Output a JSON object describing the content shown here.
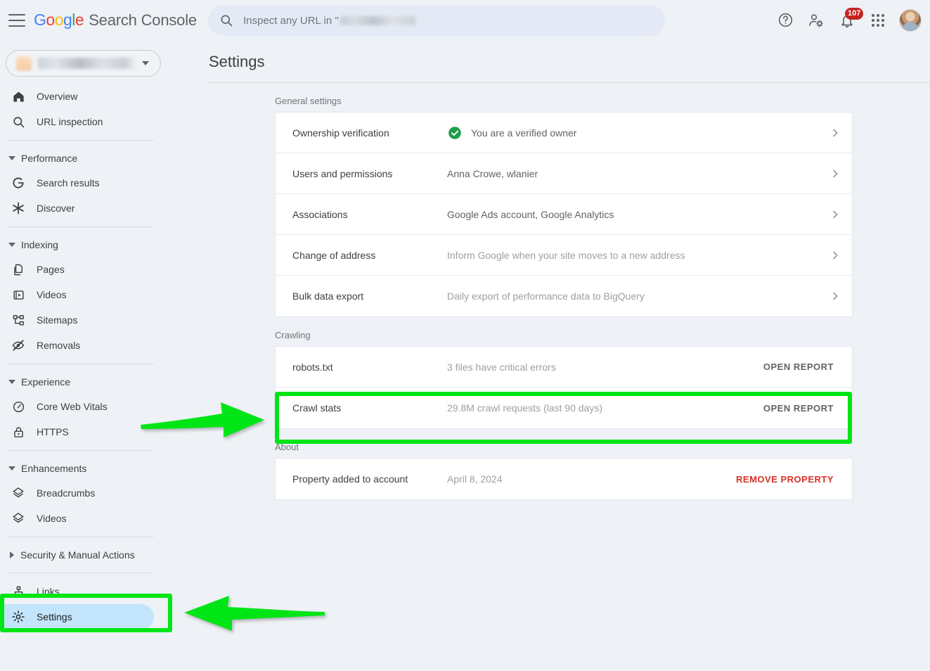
{
  "app": {
    "brand_google": "Google",
    "brand_product": "Search Console",
    "menu_icon": "hamburger-icon"
  },
  "search": {
    "placeholder_prefix": "Inspect any URL in \"",
    "icon": "search-icon"
  },
  "top_actions": {
    "help_label": "?",
    "help_icon": "help-icon",
    "account_icon": "account-settings-icon",
    "notifications_icon": "notifications-bell-icon",
    "notifications_count": "107",
    "apps_icon": "apps-grid-icon",
    "avatar_icon": "user-avatar"
  },
  "property_selector": {
    "value": "",
    "icon": "site-favicon",
    "chevron": "chevron-down-icon"
  },
  "sidebar": {
    "items": [
      {
        "label": "Overview",
        "icon": "home-icon",
        "type": "item",
        "active": false
      },
      {
        "label": "URL inspection",
        "icon": "search-icon",
        "type": "item",
        "active": false
      },
      {
        "label": "Performance",
        "icon": "triangle-down-icon",
        "type": "group",
        "expanded": true
      },
      {
        "label": "Search results",
        "icon": "google-g-icon",
        "type": "item",
        "active": false
      },
      {
        "label": "Discover",
        "icon": "discover-asterisk-icon",
        "type": "item",
        "active": false
      },
      {
        "label": "Indexing",
        "icon": "triangle-down-icon",
        "type": "group",
        "expanded": true
      },
      {
        "label": "Pages",
        "icon": "pages-icon",
        "type": "item",
        "active": false
      },
      {
        "label": "Videos",
        "icon": "video-icon",
        "type": "item",
        "active": false
      },
      {
        "label": "Sitemaps",
        "icon": "sitemaps-icon",
        "type": "item",
        "active": false
      },
      {
        "label": "Removals",
        "icon": "eye-off-icon",
        "type": "item",
        "active": false
      },
      {
        "label": "Experience",
        "icon": "triangle-down-icon",
        "type": "group",
        "expanded": true
      },
      {
        "label": "Core Web Vitals",
        "icon": "speedometer-icon",
        "type": "item",
        "active": false
      },
      {
        "label": "HTTPS",
        "icon": "lock-icon",
        "type": "item",
        "active": false
      },
      {
        "label": "Enhancements",
        "icon": "triangle-down-icon",
        "type": "group",
        "expanded": true
      },
      {
        "label": "Breadcrumbs",
        "icon": "layers-icon",
        "type": "item",
        "active": false
      },
      {
        "label": "Videos",
        "icon": "layers-icon",
        "type": "item",
        "active": false
      },
      {
        "label": "Security & Manual Actions",
        "icon": "triangle-right-icon",
        "type": "group",
        "expanded": false
      },
      {
        "label": "Links",
        "icon": "links-hierarchy-icon",
        "type": "item",
        "active": false
      },
      {
        "label": "Settings",
        "icon": "gear-icon",
        "type": "item",
        "active": true
      }
    ]
  },
  "main": {
    "page_title": "Settings",
    "sections": [
      {
        "label": "General settings",
        "rows": [
          {
            "label": "Ownership verification",
            "value": "You are a verified owner",
            "value_muted": false,
            "status_icon": "green-check-circle-icon",
            "trailing": "chevron"
          },
          {
            "label": "Users and permissions",
            "value": "Anna Crowe, wlanier",
            "value_muted": false,
            "status_icon": null,
            "trailing": "chevron"
          },
          {
            "label": "Associations",
            "value": "Google Ads account, Google Analytics",
            "value_muted": false,
            "status_icon": null,
            "trailing": "chevron"
          },
          {
            "label": "Change of address",
            "value": "Inform Google when your site moves to a new address",
            "value_muted": true,
            "status_icon": null,
            "trailing": "chevron"
          },
          {
            "label": "Bulk data export",
            "value": "Daily export of performance data to BigQuery",
            "value_muted": true,
            "status_icon": null,
            "trailing": "chevron"
          }
        ]
      },
      {
        "label": "Crawling",
        "rows": [
          {
            "label": "robots.txt",
            "value": "3 files have critical errors",
            "value_muted": true,
            "status_icon": null,
            "trailing": "link",
            "link_label": "OPEN REPORT",
            "link_danger": false
          },
          {
            "label": "Crawl stats",
            "value": "29.8M crawl requests (last 90 days)",
            "value_muted": true,
            "status_icon": null,
            "trailing": "link",
            "link_label": "OPEN REPORT",
            "link_danger": false
          }
        ]
      },
      {
        "label": "About",
        "rows": [
          {
            "label": "Property added to account",
            "value": "April 8, 2024",
            "value_muted": true,
            "status_icon": null,
            "trailing": "link",
            "link_label": "REMOVE PROPERTY",
            "link_danger": true
          }
        ]
      }
    ]
  },
  "annotations": {
    "highlight_color": "#00e515",
    "items": [
      {
        "name": "crawl-stats-highlight-box",
        "kind": "box"
      },
      {
        "name": "crawl-stats-arrow",
        "kind": "arrow-right"
      },
      {
        "name": "settings-highlight-box",
        "kind": "box"
      },
      {
        "name": "settings-arrow",
        "kind": "arrow-left"
      }
    ]
  },
  "colors": {
    "accent_blue": "#4285f4",
    "green_check": "#1e8e3e",
    "danger_red": "#d93025",
    "badge_red": "#c5221f",
    "active_pill": "#c3e5fb",
    "annotation_green": "#00e515"
  }
}
